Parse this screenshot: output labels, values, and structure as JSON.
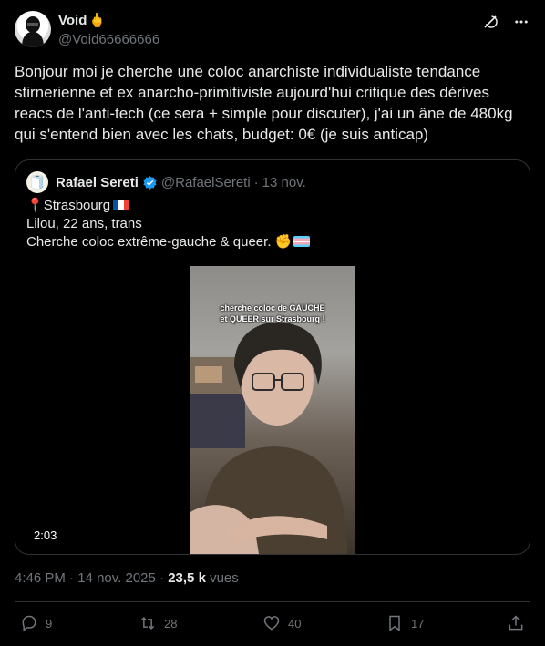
{
  "author": {
    "display_name": "Void",
    "emoji": "🖕",
    "handle": "@Void66666666"
  },
  "header_icons": [
    "grok-icon",
    "more-icon"
  ],
  "tweet": {
    "text": "Bonjour moi je cherche une coloc anarchiste individualiste tendance stirnerienne et ex anarcho-primitiviste aujourd'hui critique des dérives reacs de l'anti-tech (ce sera + simple pour discuter), j'ai un âne de 480kg qui s'entend bien avec les chats, budget: 0€ (je suis anticap)"
  },
  "quote": {
    "avatar_emoji": "🧻",
    "display_name": "Rafael Sereti",
    "handle": "@RafaelSereti",
    "separator": "·",
    "date": "13 nov.",
    "line1_pin": "📍",
    "line1_text": "Strasbourg",
    "line2": "Lilou, 22 ans, trans",
    "line3_text": "Cherche coloc extrême-gauche & queer.",
    "line3_emoji": "✊",
    "video": {
      "caption_line1": "cherche coloc de GAUCHE",
      "caption_line2": "et QUEER sur Strasbourg !",
      "duration": "2:03"
    }
  },
  "meta": {
    "time": "4:46 PM",
    "separator": "·",
    "date": "14 nov. 2025",
    "separator2": "·",
    "views_count": "23,5 k",
    "views_label": "vues"
  },
  "actions": {
    "replies": "9",
    "reposts": "28",
    "likes": "40",
    "bookmarks": "17"
  },
  "colors": {
    "background": "#000000",
    "text": "#e7e9ea",
    "muted": "#71767b",
    "border": "#2f3336",
    "verified": "#1d9bf0"
  }
}
